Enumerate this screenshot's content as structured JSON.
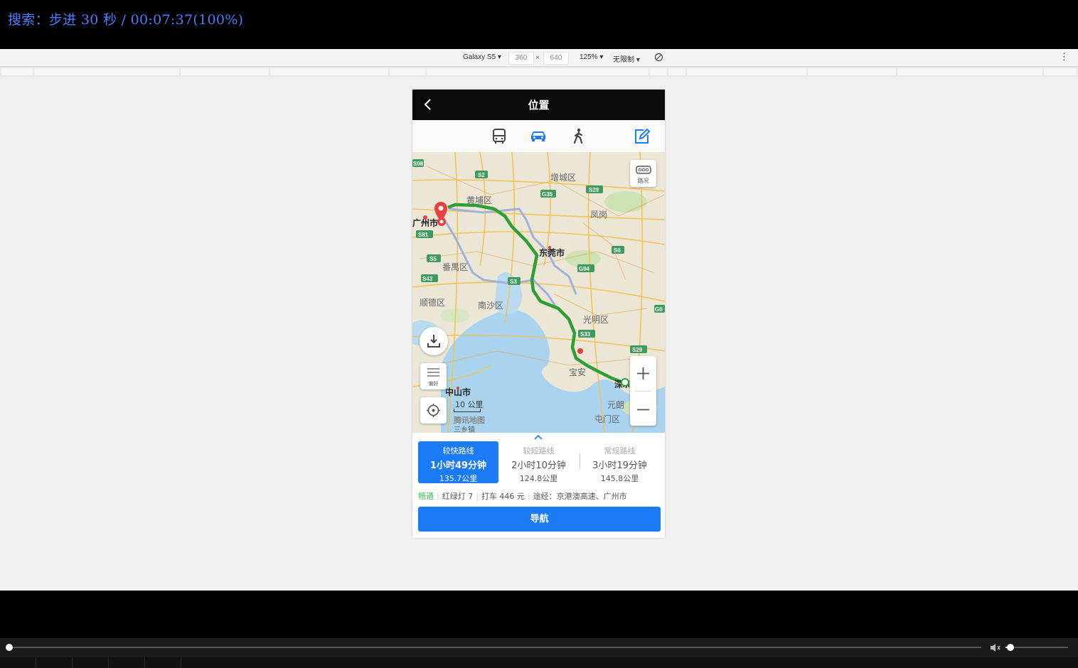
{
  "osd": {
    "text": "搜索：步进 30 秒 / 00:07:37(100%)"
  },
  "devtools": {
    "device": "Galaxy S5 ▾",
    "width": "360",
    "times": "×",
    "height": "640",
    "zoom": "125% ▾",
    "throttle": "无限制 ▾",
    "rotate_icon": "rotate-icon",
    "more": "⋮"
  },
  "phone": {
    "title": "位置",
    "modes": [
      "bus-icon",
      "car-icon",
      "walk-icon",
      "edit-icon"
    ],
    "active_mode": "car",
    "accent": "#1a7bf5",
    "map": {
      "traffic_label": "路况",
      "pref_label": "偏好",
      "scale_label": "10 公里",
      "logo_text": "腾讯地图",
      "labels": [
        "增城区",
        "黄埔区",
        "广州市",
        "番禺区",
        "东莞市",
        "顺德区",
        "南沙区",
        "光明区",
        "中山市",
        "宝安",
        "深圳",
        "元朗",
        "屯门区",
        "凤岗",
        "三乡镇"
      ],
      "highways": [
        "S08",
        "S2",
        "G35",
        "S29",
        "S81",
        "S5",
        "S43",
        "S6",
        "G94",
        "S3",
        "S33",
        "S29",
        "G0"
      ]
    },
    "routes": [
      {
        "label": "较快路线",
        "time": "1小时49分钟",
        "dist": "135.7公里",
        "active": true
      },
      {
        "label": "较短路线",
        "time": "2小时10分钟",
        "dist": "124.8公里",
        "active": false
      },
      {
        "label": "常规路线",
        "time": "3小时19分钟",
        "dist": "145.8公里",
        "active": false
      }
    ],
    "info": {
      "status": "畅通",
      "lights": "红绿灯 7",
      "taxi": "打车 446 元",
      "via": "途经：京港澳高速、广州市"
    },
    "nav_button": "导航"
  },
  "player": {
    "progress": 0.0,
    "volume": 0.08
  }
}
